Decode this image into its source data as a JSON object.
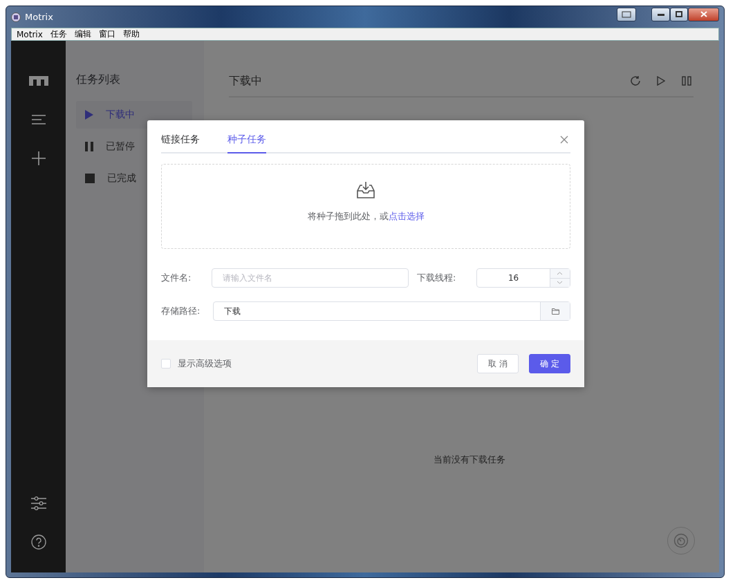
{
  "window": {
    "title": "Motrix"
  },
  "menu": [
    "Motrix",
    "任务",
    "编辑",
    "窗口",
    "帮助"
  ],
  "task_list": {
    "title": "任务列表",
    "items": [
      {
        "label": "下载中",
        "kind": "active",
        "selected": true
      },
      {
        "label": "已暂停",
        "kind": "paused",
        "selected": false
      },
      {
        "label": "已完成",
        "kind": "stopped",
        "selected": false
      }
    ]
  },
  "main": {
    "title": "下载中",
    "empty_text": "当前没有下载任务"
  },
  "dialog": {
    "tabs": [
      {
        "label": "链接任务",
        "selected": false
      },
      {
        "label": "种子任务",
        "selected": true
      }
    ],
    "dropzone": {
      "text": "将种子拖到此处，或",
      "link": "点击选择"
    },
    "file_name": {
      "label": "文件名:",
      "placeholder": "请输入文件名"
    },
    "threads": {
      "label": "下载线程:",
      "value": "16"
    },
    "save_path": {
      "label": "存储路径:",
      "value": "下载"
    },
    "advanced": {
      "label": "显示高级选项",
      "checked": false
    },
    "buttons": {
      "cancel": "取 消",
      "confirm": "确 定"
    }
  }
}
